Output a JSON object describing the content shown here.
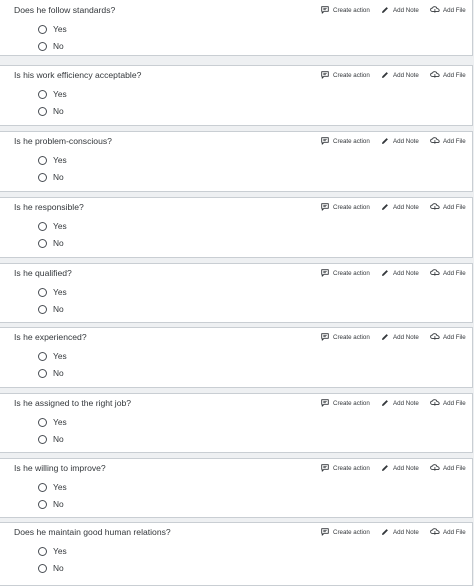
{
  "actions": {
    "create_action": "Create action",
    "add_note": "Add Note",
    "add_file": "Add File"
  },
  "options": {
    "yes": "Yes",
    "no": "No"
  },
  "questions": [
    {
      "text": "Does he follow standards?"
    },
    {
      "text": "Is his work efficiency acceptable?"
    },
    {
      "text": "Is he problem-conscious?"
    },
    {
      "text": "Is he responsible?"
    },
    {
      "text": "Is he qualified?"
    },
    {
      "text": "Is he experienced?"
    },
    {
      "text": "Is he assigned to the right job?"
    },
    {
      "text": "Is he willing to improve?"
    },
    {
      "text": "Does he maintain good human relations?"
    }
  ]
}
